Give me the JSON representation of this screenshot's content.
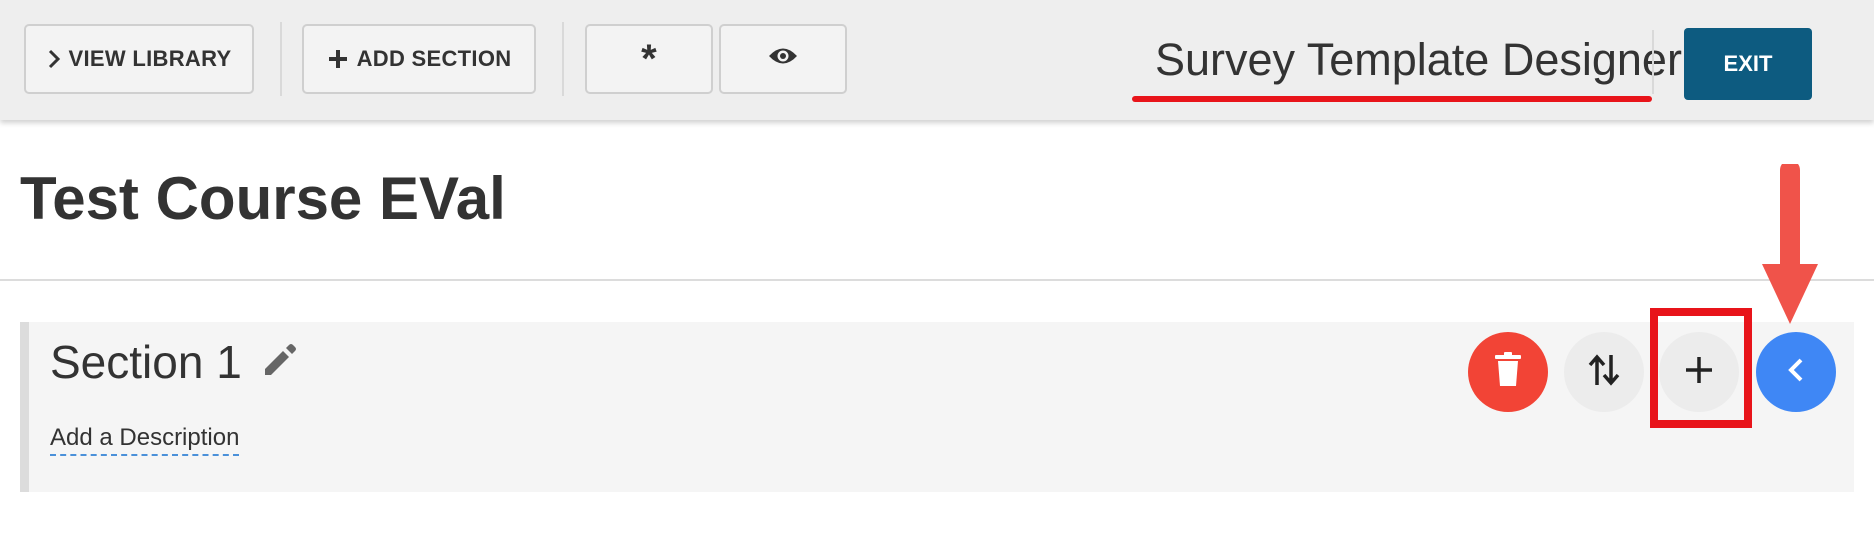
{
  "toolbar": {
    "view_library_label": "VIEW LIBRARY",
    "add_section_label": "ADD SECTION",
    "required_label": "*",
    "preview_icon": "eye-icon"
  },
  "header": {
    "designer_title": "Survey Template Designer",
    "exit_label": "EXIT"
  },
  "survey": {
    "title": "Test Course EVal"
  },
  "section": {
    "title": "Section 1",
    "description_link": "Add a Description",
    "actions": [
      "trash-icon",
      "sort-icon",
      "plus-icon",
      "chevron-left-icon"
    ]
  },
  "colors": {
    "exit_button": "#0d5b80",
    "delete_button": "#f24436",
    "collapse_button": "#3f87f5",
    "annotation_red": "#e8141a",
    "arrow": "#f0534a"
  }
}
